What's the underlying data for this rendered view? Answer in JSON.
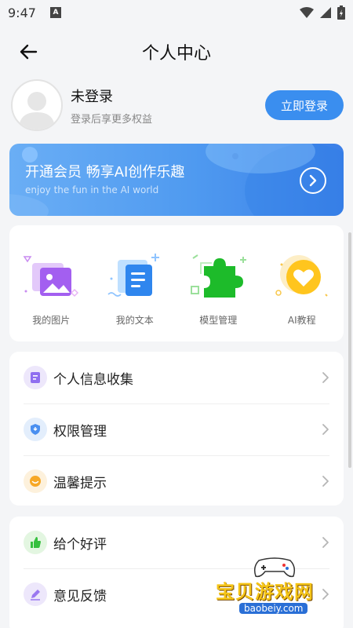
{
  "status_bar": {
    "time": "9:47",
    "notification_letter": "A"
  },
  "header": {
    "title": "个人中心"
  },
  "profile": {
    "name": "未登录",
    "subtitle": "登录后享更多权益",
    "login_button": "立即登录"
  },
  "banner": {
    "title": "开通会员 畅享AI创作乐趣",
    "subtitle": "enjoy the fun in the AI world"
  },
  "grid": [
    {
      "label": "我的图片",
      "icon": "image-icon"
    },
    {
      "label": "我的文本",
      "icon": "document-icon"
    },
    {
      "label": "模型管理",
      "icon": "puzzle-icon"
    },
    {
      "label": "AI教程",
      "icon": "heart-icon"
    }
  ],
  "menu_group_1": [
    {
      "label": "个人信息收集",
      "icon": "info-collect-icon"
    },
    {
      "label": "权限管理",
      "icon": "shield-icon"
    },
    {
      "label": "温馨提示",
      "icon": "smile-icon"
    }
  ],
  "menu_group_2": [
    {
      "label": "给个好评",
      "icon": "thumbs-up-icon"
    },
    {
      "label": "意见反馈",
      "icon": "feedback-icon"
    }
  ],
  "watermark": {
    "text": "宝贝游戏网",
    "url": "baobeiy.com"
  },
  "colors": {
    "accent": "#3a8eef",
    "background": "#f4f5f7",
    "card": "#ffffff"
  }
}
